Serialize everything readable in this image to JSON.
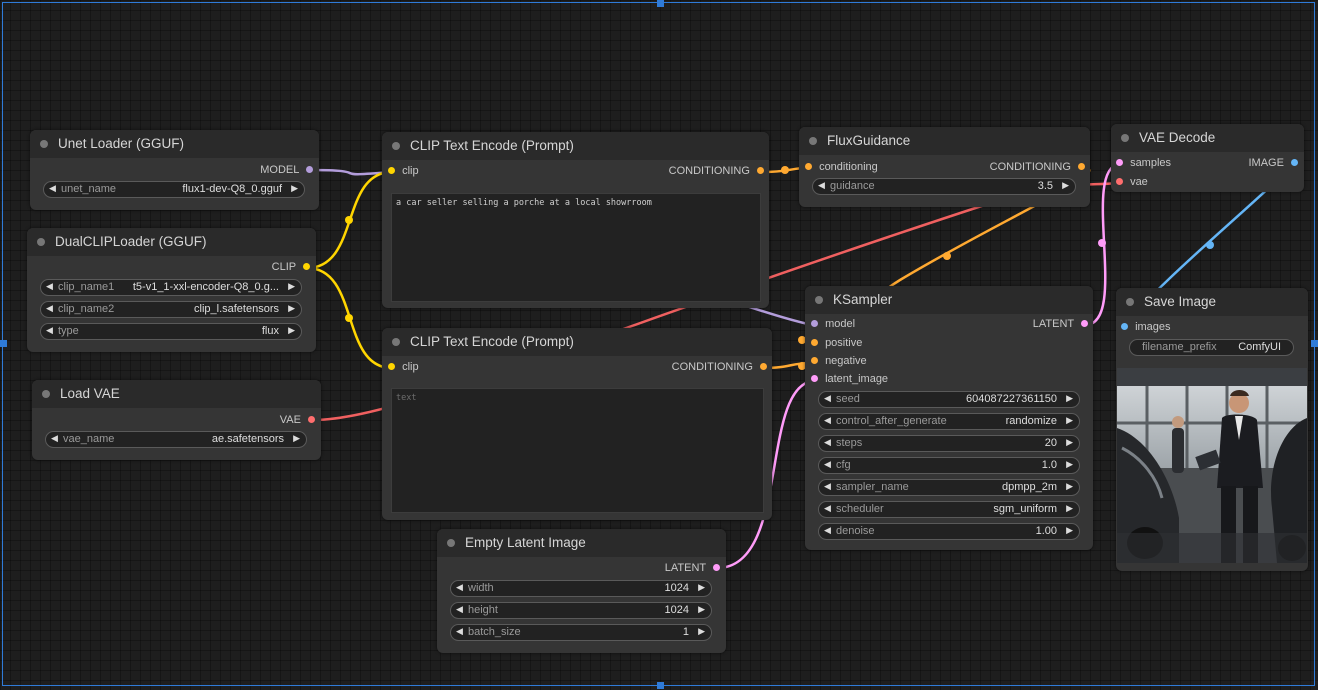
{
  "nodes": {
    "unet_loader": {
      "title": "Unet Loader (GGUF)",
      "outputs": [
        "MODEL"
      ],
      "widgets": [
        {
          "name": "unet_name",
          "value": "flux1-dev-Q8_0.gguf"
        }
      ]
    },
    "dual_clip_loader": {
      "title": "DualCLIPLoader (GGUF)",
      "outputs": [
        "CLIP"
      ],
      "widgets": [
        {
          "name": "clip_name1",
          "value": "t5-v1_1-xxl-encoder-Q8_0.g..."
        },
        {
          "name": "clip_name2",
          "value": "clip_l.safetensors"
        },
        {
          "name": "type",
          "value": "flux"
        }
      ]
    },
    "load_vae": {
      "title": "Load VAE",
      "outputs": [
        "VAE"
      ],
      "widgets": [
        {
          "name": "vae_name",
          "value": "ae.safetensors"
        }
      ]
    },
    "clip_text_encode_positive": {
      "title": "CLIP Text Encode (Prompt)",
      "inputs": [
        "clip"
      ],
      "outputs": [
        "CONDITIONING"
      ],
      "text": "a car seller selling a porche at a local showrroom"
    },
    "clip_text_encode_negative": {
      "title": "CLIP Text Encode (Prompt)",
      "inputs": [
        "clip"
      ],
      "outputs": [
        "CONDITIONING"
      ],
      "placeholder": "text"
    },
    "flux_guidance": {
      "title": "FluxGuidance",
      "inputs": [
        "conditioning"
      ],
      "outputs": [
        "CONDITIONING"
      ],
      "widgets": [
        {
          "name": "guidance",
          "value": "3.5"
        }
      ]
    },
    "ksampler": {
      "title": "KSampler",
      "inputs": [
        "model",
        "positive",
        "negative",
        "latent_image"
      ],
      "outputs": [
        "LATENT"
      ],
      "widgets": [
        {
          "name": "seed",
          "value": "604087227361150"
        },
        {
          "name": "control_after_generate",
          "value": "randomize"
        },
        {
          "name": "steps",
          "value": "20"
        },
        {
          "name": "cfg",
          "value": "1.0"
        },
        {
          "name": "sampler_name",
          "value": "dpmpp_2m"
        },
        {
          "name": "scheduler",
          "value": "sgm_uniform"
        },
        {
          "name": "denoise",
          "value": "1.00"
        }
      ]
    },
    "vae_decode": {
      "title": "VAE Decode",
      "inputs": [
        "samples",
        "vae"
      ],
      "outputs": [
        "IMAGE"
      ]
    },
    "save_image": {
      "title": "Save Image",
      "inputs": [
        "images"
      ],
      "widgets": [
        {
          "name": "filename_prefix",
          "value": "ComfyUI"
        }
      ]
    },
    "empty_latent": {
      "title": "Empty Latent Image",
      "outputs": [
        "LATENT"
      ],
      "widgets": [
        {
          "name": "width",
          "value": "1024"
        },
        {
          "name": "height",
          "value": "1024"
        },
        {
          "name": "batch_size",
          "value": "1"
        }
      ]
    }
  },
  "colors": {
    "model": "#b39ddb",
    "clip": "#ffd500",
    "vae": "#ff6e6e",
    "conditioning": "#ffa931",
    "latent": "#ff9cf9",
    "image": "#64b5f6",
    "selection": "#2f7bd8"
  },
  "icons": {
    "arrow_left": "◀",
    "arrow_right": "▶"
  }
}
